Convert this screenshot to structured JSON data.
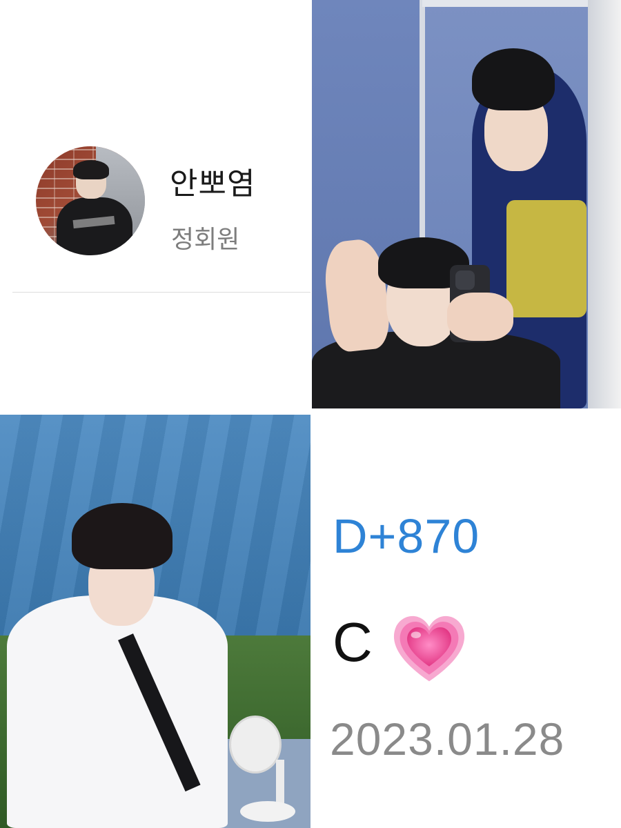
{
  "profile": {
    "name": "안뽀염",
    "subtitle": "정회원",
    "avatar_icon": "profile-photo"
  },
  "counter": {
    "dday": "D+870",
    "letter": "C",
    "heart_icon": "growing-heart-icon",
    "heart_color": "#f0449a",
    "date": "2023.01.28"
  },
  "colors": {
    "dday_blue": "#2e83d6",
    "date_gray": "#8a8a8a",
    "name_black": "#1a1a1a",
    "subtitle_gray": "#7d7d7d"
  }
}
